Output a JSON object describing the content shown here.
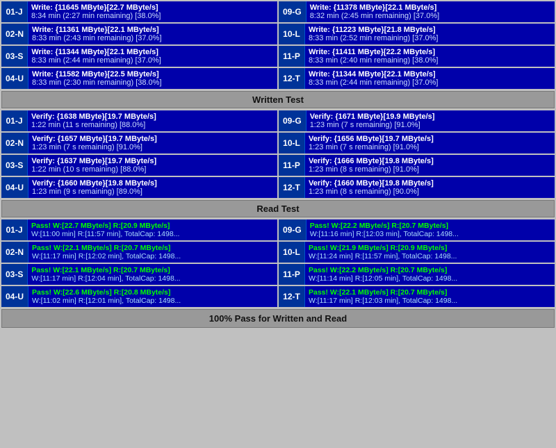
{
  "sections": {
    "write_header": "Written Test",
    "read_header": "Read Test",
    "footer": "100% Pass for Written and Read"
  },
  "write_rows": [
    {
      "left": {
        "id": "01-J",
        "line1": "Write: {11645 MByte}[22.7 MByte/s]",
        "line2": "8:34 min (2:27 min remaining)  [38.0%]"
      },
      "right": {
        "id": "09-G",
        "line1": "Write: {11378 MByte}[22.1 MByte/s]",
        "line2": "8:32 min (2:45 min remaining)  [37.0%]"
      }
    },
    {
      "left": {
        "id": "02-N",
        "line1": "Write: {11361 MByte}[22.1 MByte/s]",
        "line2": "8:33 min (2:43 min remaining)  [37.0%]"
      },
      "right": {
        "id": "10-L",
        "line1": "Write: {11223 MByte}[21.8 MByte/s]",
        "line2": "8:33 min (2:52 min remaining)  [37.0%]"
      }
    },
    {
      "left": {
        "id": "03-S",
        "line1": "Write: {11344 MByte}[22.1 MByte/s]",
        "line2": "8:33 min (2:44 min remaining)  [37.0%]"
      },
      "right": {
        "id": "11-P",
        "line1": "Write: {11411 MByte}[22.2 MByte/s]",
        "line2": "8:33 min (2:40 min remaining)  [38.0%]"
      }
    },
    {
      "left": {
        "id": "04-U",
        "line1": "Write: {11582 MByte}[22.5 MByte/s]",
        "line2": "8:33 min (2:30 min remaining)  [38.0%]"
      },
      "right": {
        "id": "12-T",
        "line1": "Write: {11344 MByte}[22.1 MByte/s]",
        "line2": "8:33 min (2:44 min remaining)  [37.0%]"
      }
    }
  ],
  "verify_rows": [
    {
      "left": {
        "id": "01-J",
        "line1": "Verify: {1638 MByte}[19.7 MByte/s]",
        "line2": "1:22 min (11 s remaining)  [88.0%]"
      },
      "right": {
        "id": "09-G",
        "line1": "Verify: {1671 MByte}[19.9 MByte/s]",
        "line2": "1:23 min (7 s remaining)   [91.0%]"
      }
    },
    {
      "left": {
        "id": "02-N",
        "line1": "Verify: {1657 MByte}[19.7 MByte/s]",
        "line2": "1:23 min (7 s remaining)   [91.0%]"
      },
      "right": {
        "id": "10-L",
        "line1": "Verify: {1656 MByte}[19.7 MByte/s]",
        "line2": "1:23 min (7 s remaining)   [91.0%]"
      }
    },
    {
      "left": {
        "id": "03-S",
        "line1": "Verify: {1637 MByte}[19.7 MByte/s]",
        "line2": "1:22 min (10 s remaining)  [88.0%]"
      },
      "right": {
        "id": "11-P",
        "line1": "Verify: {1666 MByte}[19.8 MByte/s]",
        "line2": "1:23 min (8 s remaining)   [91.0%]"
      }
    },
    {
      "left": {
        "id": "04-U",
        "line1": "Verify: {1660 MByte}[19.8 MByte/s]",
        "line2": "1:23 min (9 s remaining)   [89.0%]"
      },
      "right": {
        "id": "12-T",
        "line1": "Verify: {1660 MByte}[19.8 MByte/s]",
        "line2": "1:23 min (8 s remaining)   [90.0%]"
      }
    }
  ],
  "pass_rows": [
    {
      "left": {
        "id": "01-J",
        "line1": "Pass! W:[22.7 MByte/s] R:[20.9 MByte/s]",
        "line2": "W:[11:00 min] R:[11:57 min], TotalCap: 1498..."
      },
      "right": {
        "id": "09-G",
        "line1": "Pass! W:[22.2 MByte/s] R:[20.7 MByte/s]",
        "line2": "W:[11:16 min] R:[12:03 min], TotalCap: 1498..."
      }
    },
    {
      "left": {
        "id": "02-N",
        "line1": "Pass! W:[22.1 MByte/s] R:[20.7 MByte/s]",
        "line2": "W:[11:17 min] R:[12:02 min], TotalCap: 1498..."
      },
      "right": {
        "id": "10-L",
        "line1": "Pass! W:[21.9 MByte/s] R:[20.9 MByte/s]",
        "line2": "W:[11:24 min] R:[11:57 min], TotalCap: 1498..."
      }
    },
    {
      "left": {
        "id": "03-S",
        "line1": "Pass! W:[22.1 MByte/s] R:[20.7 MByte/s]",
        "line2": "W:[11:17 min] R:[12:04 min], TotalCap: 1498..."
      },
      "right": {
        "id": "11-P",
        "line1": "Pass! W:[22.2 MByte/s] R:[20.7 MByte/s]",
        "line2": "W:[11:14 min] R:[12:05 min], TotalCap: 1498..."
      }
    },
    {
      "left": {
        "id": "04-U",
        "line1": "Pass! W:[22.6 MByte/s] R:[20.8 MByte/s]",
        "line2": "W:[11:02 min] R:[12:01 min], TotalCap: 1498..."
      },
      "right": {
        "id": "12-T",
        "line1": "Pass! W:[22.1 MByte/s] R:[20.7 MByte/s]",
        "line2": "W:[11:17 min] R:[12:03 min], TotalCap: 1498..."
      }
    }
  ]
}
